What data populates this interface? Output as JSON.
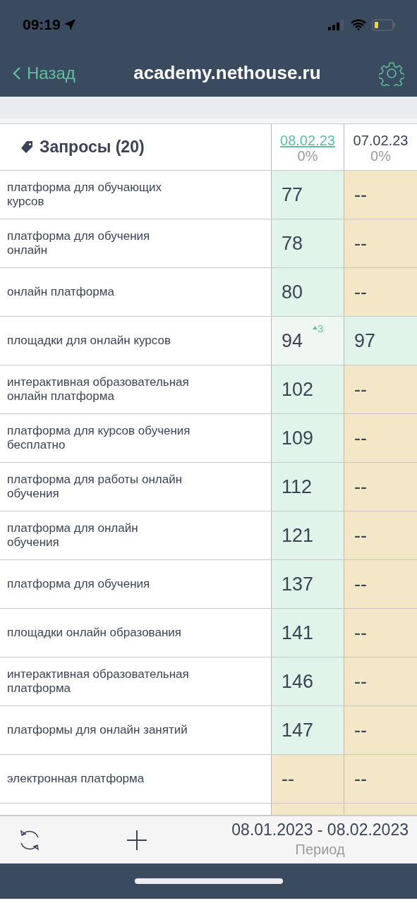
{
  "status_bar": {
    "time": "09:19"
  },
  "nav": {
    "back": "Назад",
    "title": "academy.nethouse.ru"
  },
  "table": {
    "title": "Запросы (20)",
    "columns": [
      {
        "date": "08.02.23",
        "percent": "0%",
        "selected": true
      },
      {
        "date": "07.02.23",
        "percent": "0%",
        "selected": false
      }
    ],
    "rows": [
      {
        "query": "платформа для обучающих курсов",
        "cells": [
          {
            "kind": "ranked",
            "text": "77"
          },
          {
            "kind": "missing",
            "text": "--"
          }
        ]
      },
      {
        "query": "платформа для обучения онлайн",
        "cells": [
          {
            "kind": "ranked",
            "text": "78"
          },
          {
            "kind": "missing",
            "text": "--"
          }
        ]
      },
      {
        "query": "онлайн платформа",
        "cells": [
          {
            "kind": "ranked",
            "text": "80"
          },
          {
            "kind": "missing",
            "text": "--"
          }
        ]
      },
      {
        "query": "площадки для онлайн курсов",
        "cells": [
          {
            "kind": "improved",
            "text": "94",
            "change": "3"
          },
          {
            "kind": "ranked",
            "text": "97"
          }
        ]
      },
      {
        "query": "интерактивная образовательная онлайн платформа",
        "cells": [
          {
            "kind": "ranked",
            "text": "102"
          },
          {
            "kind": "missing",
            "text": "--"
          }
        ]
      },
      {
        "query": "платформа для курсов обучения бесплатно",
        "cells": [
          {
            "kind": "ranked",
            "text": "109"
          },
          {
            "kind": "missing",
            "text": "--"
          }
        ]
      },
      {
        "query": "платформа для работы онлайн обучения",
        "cells": [
          {
            "kind": "ranked",
            "text": "112"
          },
          {
            "kind": "missing",
            "text": "--"
          }
        ]
      },
      {
        "query": "платформа для онлайн обучения",
        "cells": [
          {
            "kind": "ranked",
            "text": "121"
          },
          {
            "kind": "missing",
            "text": "--"
          }
        ]
      },
      {
        "query": "платформа для обучения",
        "cells": [
          {
            "kind": "ranked",
            "text": "137"
          },
          {
            "kind": "missing",
            "text": "--"
          }
        ]
      },
      {
        "query": "площадки онлайн образования",
        "cells": [
          {
            "kind": "ranked",
            "text": "141"
          },
          {
            "kind": "missing",
            "text": "--"
          }
        ]
      },
      {
        "query": "интерактивная образовательная платформа",
        "cells": [
          {
            "kind": "ranked",
            "text": "146"
          },
          {
            "kind": "missing",
            "text": "--"
          }
        ]
      },
      {
        "query": "платформы для онлайн занятий",
        "cells": [
          {
            "kind": "ranked",
            "text": "147"
          },
          {
            "kind": "missing",
            "text": "--"
          }
        ]
      },
      {
        "query": "электронная платформа",
        "cells": [
          {
            "kind": "missing",
            "text": "--"
          },
          {
            "kind": "missing",
            "text": "--"
          }
        ]
      },
      {
        "cells": [
          {
            "kind": "missing"
          },
          {
            "kind": "missing"
          }
        ]
      }
    ]
  },
  "toolbar": {
    "period": "08.01.2023 - 08.02.2023",
    "period_label": "Период"
  }
}
